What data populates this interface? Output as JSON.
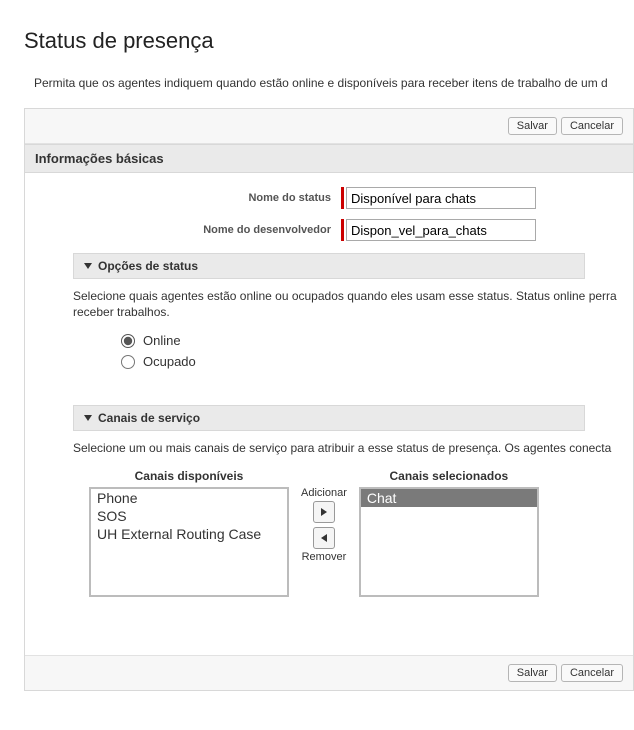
{
  "page": {
    "title": "Status de presença",
    "description": "Permita que os agentes indiquem quando estão online e disponíveis para receber itens de trabalho de um d"
  },
  "buttons": {
    "save": "Salvar",
    "cancel": "Cancelar"
  },
  "basic_info": {
    "header": "Informações básicas",
    "status_name_label": "Nome do status",
    "status_name_value": "Disponível para chats",
    "developer_name_label": "Nome do desenvolvedor",
    "developer_name_value": "Dispon_vel_para_chats"
  },
  "status_options": {
    "header": "Opções de status",
    "description": "Selecione quais agentes estão online ou ocupados quando eles usam esse status. Status online perra",
    "description_line2": "receber trabalhos.",
    "online_label": "Online",
    "busy_label": "Ocupado",
    "selected": "online"
  },
  "service_channels": {
    "header": "Canais de serviço",
    "description": "Selecione um ou mais canais de serviço para atribuir a esse status de presença. Os agentes conecta",
    "available_title": "Canais disponíveis",
    "selected_title": "Canais selecionados",
    "add_label": "Adicionar",
    "remove_label": "Remover",
    "available": [
      "Phone",
      "SOS",
      "UH External Routing Case"
    ],
    "selected": [
      "Chat"
    ]
  }
}
